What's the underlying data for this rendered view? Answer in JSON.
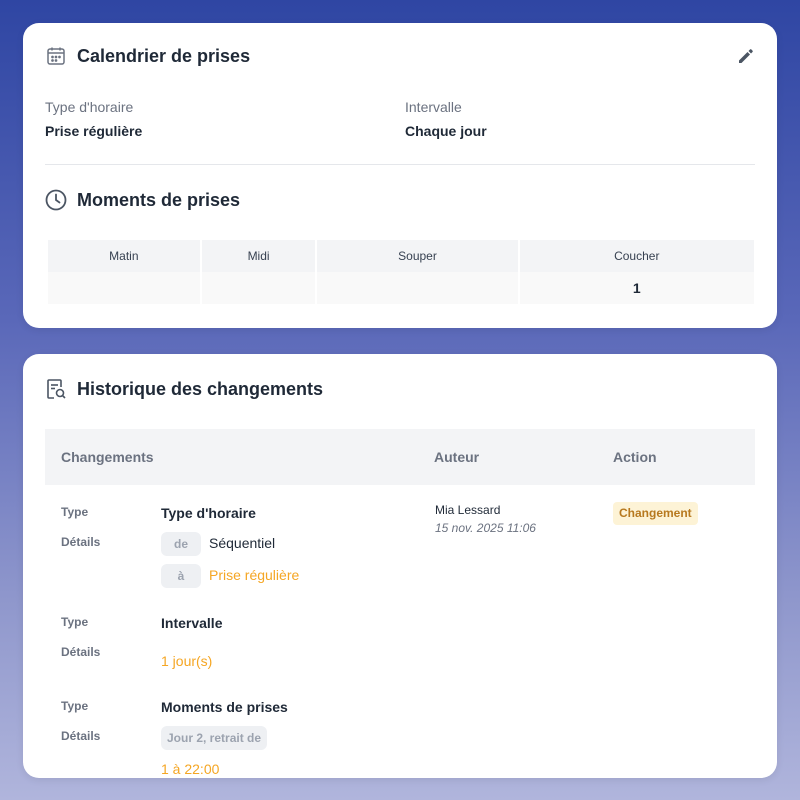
{
  "schedule": {
    "title": "Calendrier de prises",
    "schedule_type_label": "Type d'horaire",
    "schedule_type_value": "Prise régulière",
    "interval_label": "Intervalle",
    "interval_value": "Chaque jour",
    "icon": "calendar-icon",
    "edit_icon": "pencil-icon"
  },
  "moments": {
    "title": "Moments de prises",
    "icon": "clock-icon",
    "columns": [
      "Matin",
      "Midi",
      "Souper",
      "Coucher"
    ],
    "values": [
      "",
      "",
      "",
      "1"
    ]
  },
  "history": {
    "title": "Historique des changements",
    "icon": "history-search-icon",
    "columns": {
      "changes": "Changements",
      "author": "Auteur",
      "action": "Action"
    },
    "entry": {
      "author": "Mia Lessard",
      "date": "15 nov. 2025 11:06",
      "action": "Changement"
    },
    "changes": [
      {
        "type_label": "Type",
        "type": "Type d'horaire",
        "details_label": "Détails",
        "from_label": "de",
        "from_value": "Séquentiel",
        "to_label": "à",
        "to_value": "Prise régulière"
      },
      {
        "type_label": "Type",
        "type": "Intervalle",
        "details_label": "Détails",
        "to_value": "1 jour(s)"
      },
      {
        "type_label": "Type",
        "type": "Moments de prises",
        "details_label": "Détails",
        "pill": "Jour 2, retrait de",
        "to_value": "1 à 22:00"
      }
    ]
  },
  "colors": {
    "accent_orange": "#f5a623",
    "badge_bg": "#fdf3d6",
    "badge_text": "#b7791f",
    "background_top": "#2f46a3",
    "background_bottom": "#b0b5dc"
  }
}
